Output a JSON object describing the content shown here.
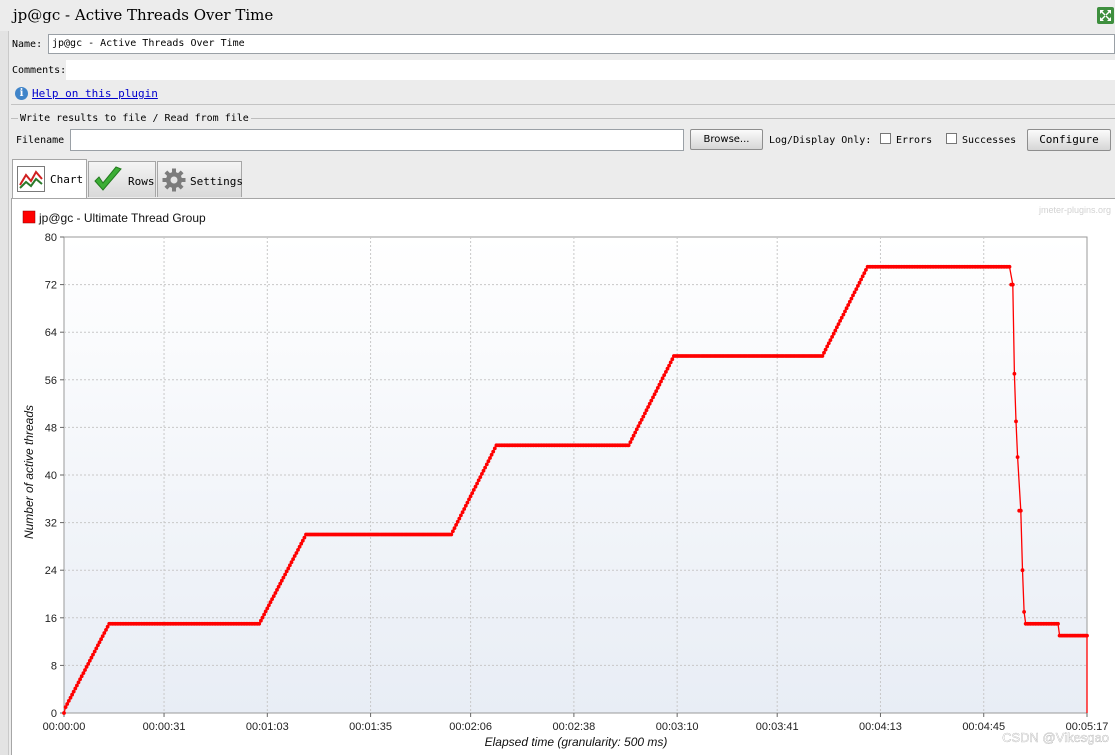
{
  "window": {
    "title": "jp@gc - Active Threads Over Time"
  },
  "form": {
    "name_label": "Name:",
    "name_value": "jp@gc - Active Threads Over Time",
    "comments_label": "Comments:",
    "comments_value": "",
    "help_link": "Help on this plugin"
  },
  "file_panel": {
    "legend": "Write results to file / Read from file",
    "filename_label": "Filename",
    "filename_value": "",
    "browse_label": "Browse...",
    "log_display_label": "Log/Display Only:",
    "errors_label": "Errors",
    "successes_label": "Successes",
    "configure_label": "Configure"
  },
  "tabs": [
    {
      "label": "Chart",
      "icon": "chart-icon",
      "active": true
    },
    {
      "label": "Rows",
      "icon": "checkmark-icon",
      "active": false
    },
    {
      "label": "Settings",
      "icon": "gear-icon",
      "active": false
    }
  ],
  "watermarks": {
    "plugin": "jmeter-plugins.org",
    "csdn": "CSDN @Vikesgao"
  },
  "colors": {
    "series": "#ff0000",
    "plot_top": "#ffffff",
    "plot_bottom": "#e8edf5",
    "grid": "#c8c8c8"
  },
  "chart_data": {
    "type": "line",
    "xlabel": "Elapsed time (granularity: 500 ms)",
    "ylabel": "Number of active threads",
    "xlim": [
      0,
      317
    ],
    "ylim": [
      0,
      80
    ],
    "x_ticks": [
      0,
      31,
      63,
      95,
      126,
      158,
      190,
      221,
      253,
      285,
      317
    ],
    "x_tick_labels": [
      "00:00:00",
      "00:00:31",
      "00:01:03",
      "00:01:35",
      "00:02:06",
      "00:02:38",
      "00:03:10",
      "00:03:41",
      "00:04:13",
      "00:04:45",
      "00:05:17"
    ],
    "y_ticks": [
      0,
      8,
      16,
      24,
      32,
      40,
      48,
      56,
      64,
      72,
      80
    ],
    "grid": true,
    "legend_position": "top-left",
    "series": [
      {
        "name": "jp@gc - Ultimate Thread Group",
        "x": [
          0,
          0.5,
          14,
          60.5,
          75,
          120,
          134,
          175,
          189,
          235,
          249,
          293,
          294,
          294.5,
          295,
          295.5,
          296.5,
          297,
          297.5,
          298,
          308,
          308.5,
          317,
          317
        ],
        "y": [
          0,
          1,
          15,
          15,
          30,
          30,
          45,
          45,
          60,
          60,
          75,
          75,
          72,
          57,
          49,
          43,
          34,
          24,
          17,
          15,
          15,
          13,
          13,
          0
        ]
      }
    ]
  }
}
